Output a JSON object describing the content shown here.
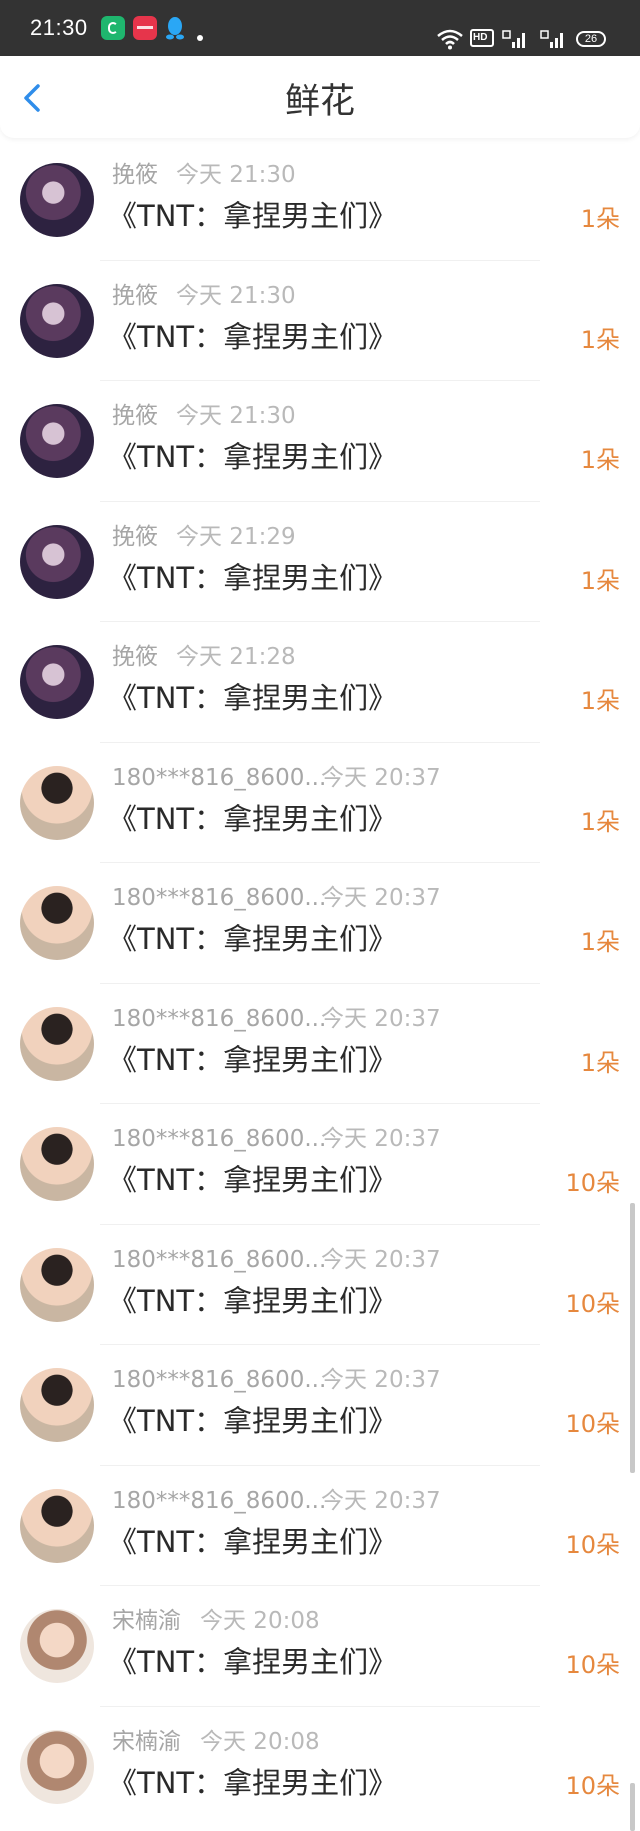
{
  "status_bar": {
    "time": "21:30",
    "battery": "26"
  },
  "header": {
    "title": "鲜花"
  },
  "items": [
    {
      "user": "挽筱",
      "time": "今天 21:30",
      "book": "《TNT：拿捏男主们》",
      "count": "1朵"
    },
    {
      "user": "挽筱",
      "time": "今天 21:30",
      "book": "《TNT：拿捏男主们》",
      "count": "1朵"
    },
    {
      "user": "挽筱",
      "time": "今天 21:30",
      "book": "《TNT：拿捏男主们》",
      "count": "1朵"
    },
    {
      "user": "挽筱",
      "time": "今天 21:29",
      "book": "《TNT：拿捏男主们》",
      "count": "1朵"
    },
    {
      "user": "挽筱",
      "time": "今天 21:28",
      "book": "《TNT：拿捏男主们》",
      "count": "1朵"
    },
    {
      "user": "180***816_8600...",
      "time": "今天 20:37",
      "book": "《TNT：拿捏男主们》",
      "count": "1朵"
    },
    {
      "user": "180***816_8600...",
      "time": "今天 20:37",
      "book": "《TNT：拿捏男主们》",
      "count": "1朵"
    },
    {
      "user": "180***816_8600...",
      "time": "今天 20:37",
      "book": "《TNT：拿捏男主们》",
      "count": "1朵"
    },
    {
      "user": "180***816_8600...",
      "time": "今天 20:37",
      "book": "《TNT：拿捏男主们》",
      "count": "10朵"
    },
    {
      "user": "180***816_8600...",
      "time": "今天 20:37",
      "book": "《TNT：拿捏男主们》",
      "count": "10朵"
    },
    {
      "user": "180***816_8600...",
      "time": "今天 20:37",
      "book": "《TNT：拿捏男主们》",
      "count": "10朵"
    },
    {
      "user": "180***816_8600...",
      "time": "今天 20:37",
      "book": "《TNT：拿捏男主们》",
      "count": "10朵"
    },
    {
      "user": "宋楠渝",
      "time": "今天 20:08",
      "book": "《TNT：拿捏男主们》",
      "count": "10朵"
    },
    {
      "user": "宋楠渝",
      "time": "今天 20:08",
      "book": "《TNT：拿捏男主们》",
      "count": "10朵"
    }
  ]
}
